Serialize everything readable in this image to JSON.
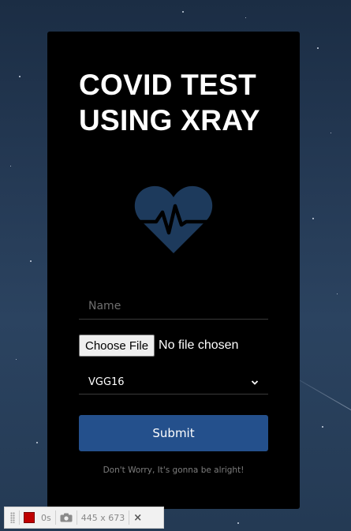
{
  "card": {
    "title": "COVID TEST\nUSING XRAY",
    "heart_icon": "heart-pulse-icon",
    "heart_color": "#1d3a5c"
  },
  "form": {
    "name_placeholder": "Name",
    "name_value": "",
    "file_button_label": "Choose File",
    "file_status": "No file chosen",
    "model_selected": "VGG16",
    "submit_label": "Submit",
    "submit_color": "#24508c"
  },
  "footer": {
    "note": "Don't Worry, It's gonna be alright!"
  },
  "devbar": {
    "timer": "0s",
    "dimensions": "445 x 673",
    "close": "×"
  }
}
